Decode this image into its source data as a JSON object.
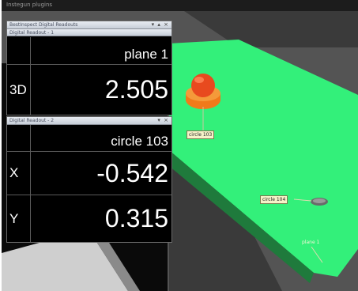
{
  "app": {
    "plugins_label": "Instegun plugins"
  },
  "readout1": {
    "title": "BestInspect Digital Readouts",
    "sub_title": "Digital Readout - 1",
    "controls": "▾ ▴ ×",
    "feature_name": "plane 1",
    "rows": [
      {
        "label": "3D",
        "value": "2.505"
      }
    ]
  },
  "readout2": {
    "title": "Digital Readout - 2",
    "controls": "▾ ×",
    "feature_name": "circle 103",
    "rows": [
      {
        "label": "X",
        "value": "-0.542"
      },
      {
        "label": "Y",
        "value": "0.315"
      }
    ]
  },
  "scene": {
    "labels": {
      "circle_103": "circle 103",
      "circle_104": "circle 104",
      "plane_1": "plane 1"
    },
    "colors": {
      "plane": "#33f07a",
      "sphere": "#e84a1e",
      "base": "#f07a1a",
      "background": "#555555"
    }
  }
}
